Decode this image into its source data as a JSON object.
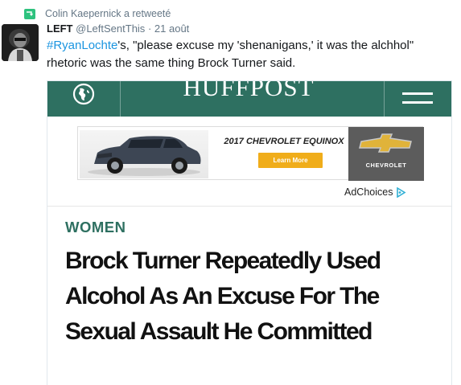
{
  "retweet": {
    "text": "Colin Kaepernick a retweeté",
    "icon": "retweet-icon"
  },
  "tweet": {
    "author": "LEFT",
    "handle": "@LeftSentThis",
    "separator": "·",
    "date": "21 août",
    "hashtag": "#RyanLochte",
    "text_rest": "'s, \"please excuse my 'shenanigans,' it was the alchhol\" rhetoric was the same thing Brock Turner said."
  },
  "media": {
    "logo": "HUFFPOST",
    "ad": {
      "title": "2017 CHEVROLET EQUINOX",
      "button": "Learn More",
      "brand": "CHEVROLET"
    },
    "adchoices": "AdChoices",
    "section": "WOMEN",
    "headline": "Brock Turner Repeatedly Used Alcohol As An Excuse For The Sexual Assault He Committed"
  },
  "colors": {
    "huffpost_green": "#2e7061",
    "link_blue": "#1b95e0",
    "retweet_green": "#2ec27e",
    "ad_button": "#f0ad1a"
  }
}
